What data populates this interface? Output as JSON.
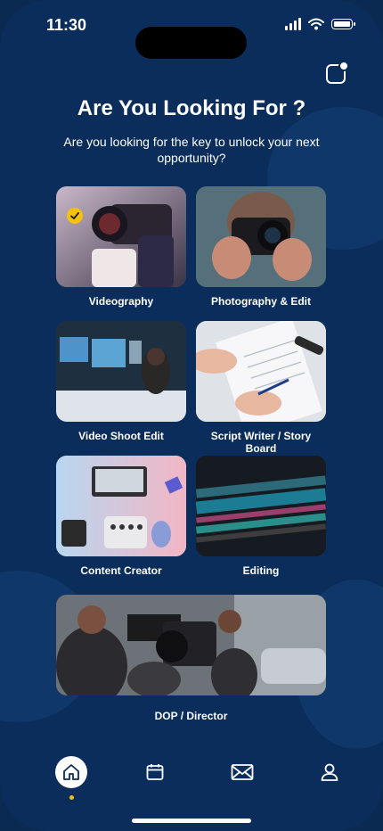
{
  "status": {
    "time": "11:30"
  },
  "header": {
    "title": "Are You Looking For ?",
    "subtitle": "Are you looking for the key to unlock your next opportunity?"
  },
  "categories": [
    {
      "label": "Videography",
      "selected": true,
      "image": "camera operator with video camera"
    },
    {
      "label": "Photography & Edit",
      "selected": false,
      "image": "hands holding DSLR camera"
    },
    {
      "label": "Video Shoot Edit",
      "selected": false,
      "image": "editing studio with monitors"
    },
    {
      "label": "Script Writer / Story Board",
      "selected": false,
      "image": "hand writing on script paper"
    },
    {
      "label": "Content Creator",
      "selected": false,
      "image": "desk with laptop and gear"
    },
    {
      "label": "Editing",
      "selected": false,
      "image": "video editing timeline"
    },
    {
      "label": "DOP / Director",
      "selected": false,
      "image": "film crew with cinema camera"
    }
  ],
  "nav": {
    "items": [
      "home-icon",
      "calendar-icon",
      "mail-icon",
      "profile-icon"
    ],
    "active": "home-icon"
  },
  "colors": {
    "background": "#0b2d5b",
    "accent": "#f4c20d",
    "text": "#ffffff"
  }
}
